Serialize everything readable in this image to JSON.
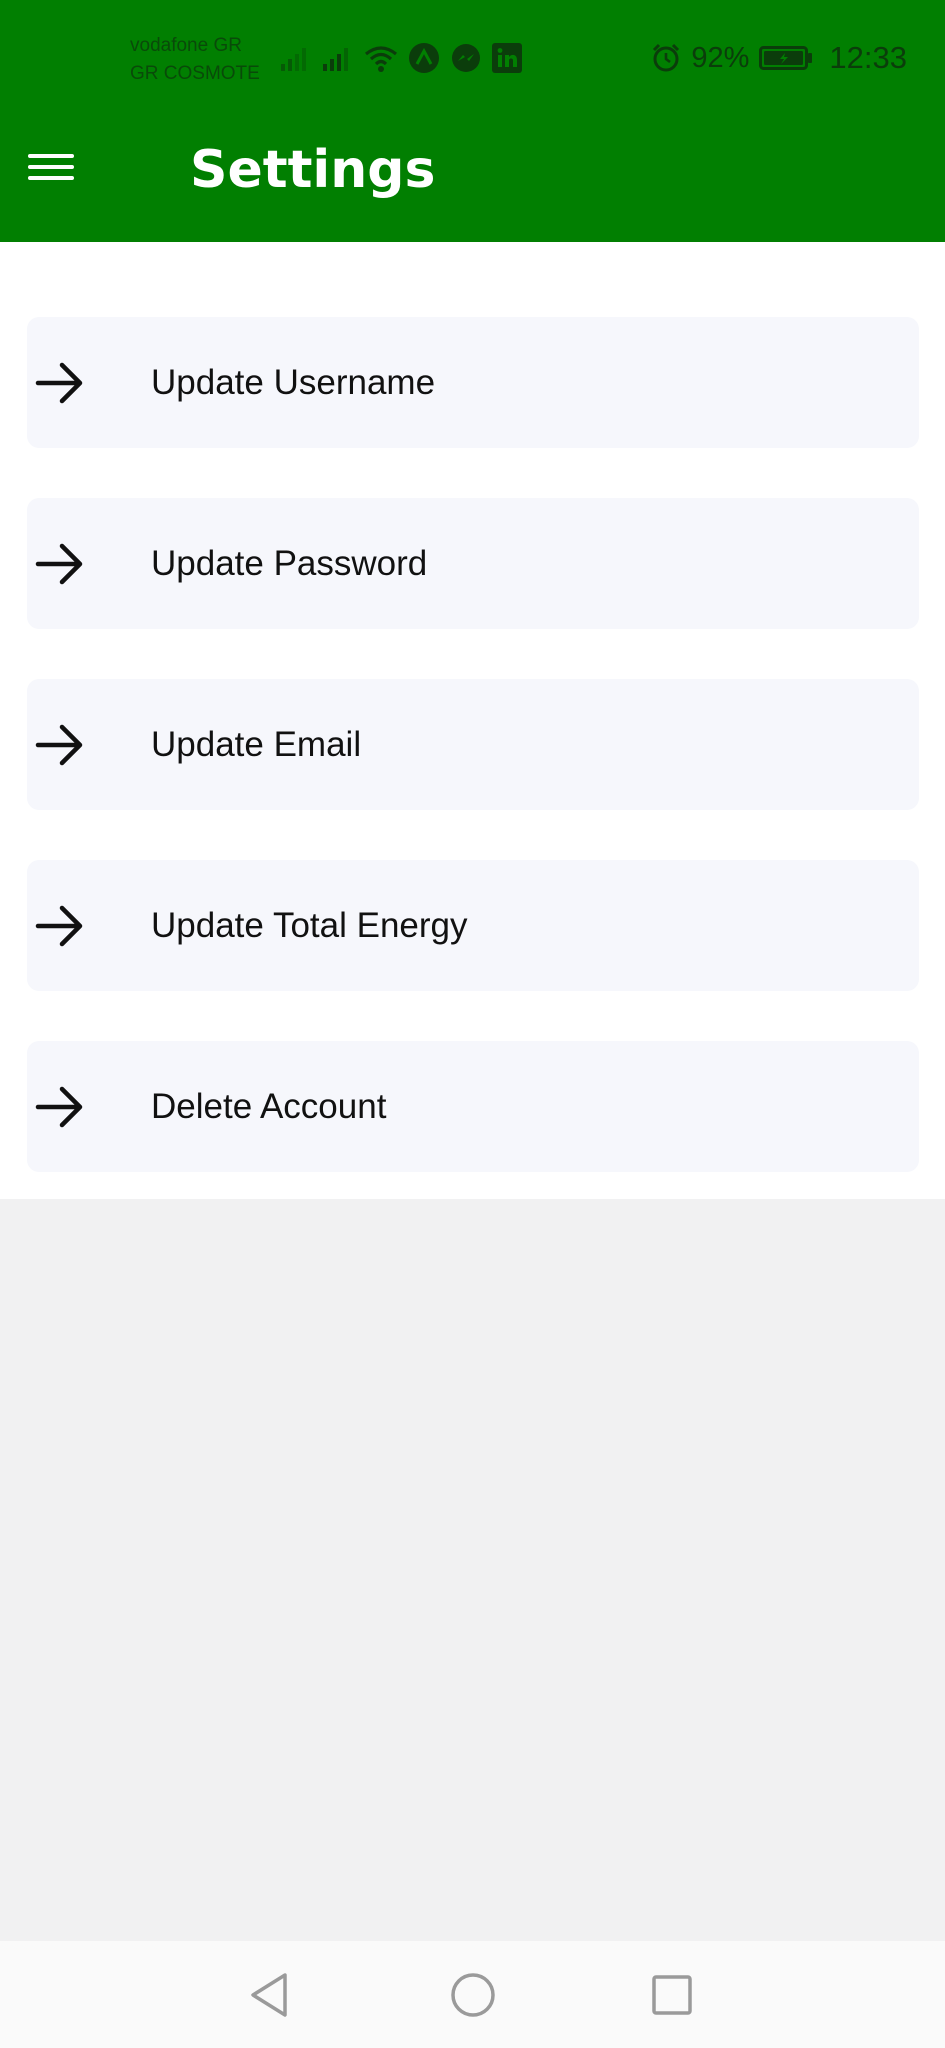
{
  "status_bar": {
    "carrier_1": "vodafone GR",
    "carrier_2": "GR COSMOTE",
    "battery_percent": "92%",
    "time": "12:33",
    "icons": [
      "signal-icon",
      "signal-icon",
      "wifi-icon",
      "app-notification-icon",
      "messenger-icon",
      "linkedin-icon",
      "alarm-icon",
      "battery-icon"
    ]
  },
  "header": {
    "title": "Settings",
    "background_color": "#017f01"
  },
  "settings": {
    "items": [
      {
        "label": "Update Username",
        "icon": "arrow-right-icon"
      },
      {
        "label": "Update Password",
        "icon": "arrow-right-icon"
      },
      {
        "label": "Update Email",
        "icon": "arrow-right-icon"
      },
      {
        "label": "Update Total Energy",
        "icon": "arrow-right-icon"
      },
      {
        "label": "Delete Account",
        "icon": "arrow-right-icon"
      }
    ]
  },
  "nav_bar": {
    "buttons": [
      "back-icon",
      "home-icon",
      "recents-icon"
    ]
  }
}
